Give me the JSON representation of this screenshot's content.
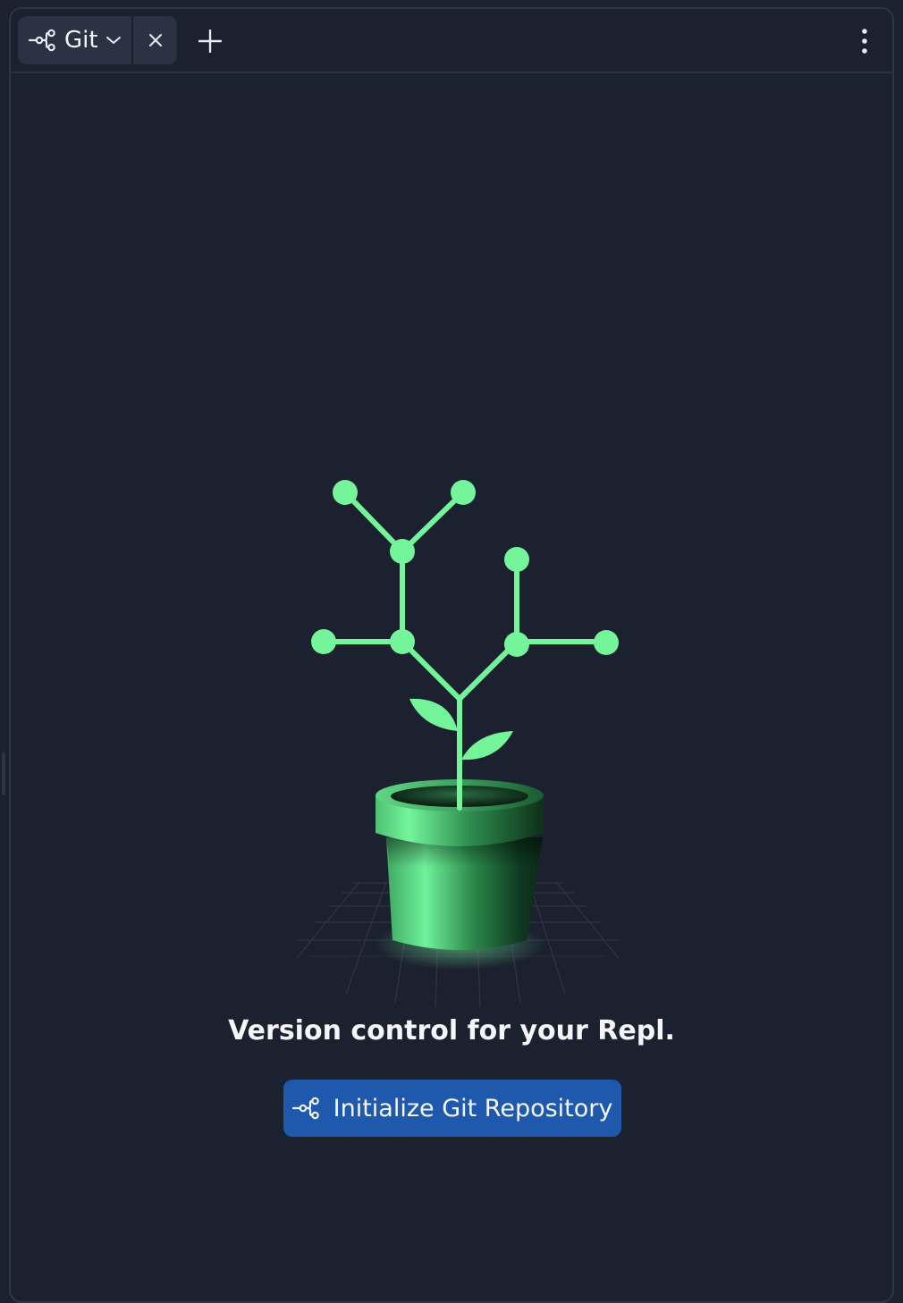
{
  "tab": {
    "title": "Git",
    "icon": "git-branch-icon",
    "dropdown_icon": "chevron-down-icon",
    "close_icon": "close-icon"
  },
  "toolbar": {
    "add_icon": "plus-icon",
    "menu_icon": "more-vertical-icon"
  },
  "main": {
    "illustration": "git-plant-illustration",
    "tagline": "Version control for your Repl.",
    "init_button_label": "Initialize Git Repository",
    "init_button_icon": "git-branch-icon"
  },
  "colors": {
    "background": "#1c2130",
    "tab_bg": "#2b3243",
    "accent_green": "#74f59a",
    "button_blue": "#1e59ad",
    "text": "#f5f6f9"
  }
}
